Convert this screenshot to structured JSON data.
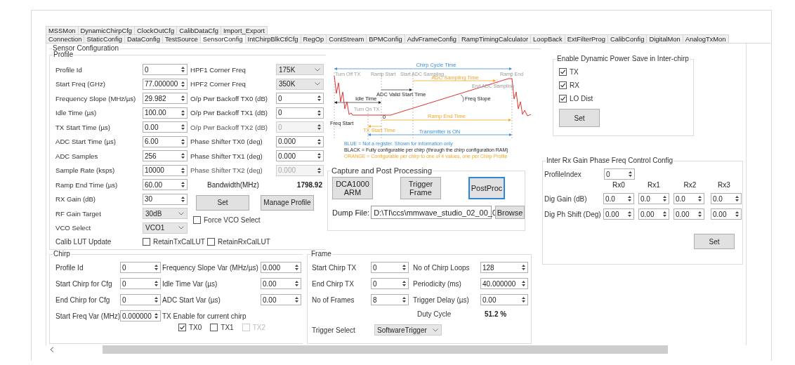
{
  "tabs_row1": [
    {
      "label": "MSSMon",
      "selected": false
    },
    {
      "label": "DynamicChirpCfg",
      "selected": false
    },
    {
      "label": "ClockOutCfg",
      "selected": false
    },
    {
      "label": "CalibDataCfg",
      "selected": false
    },
    {
      "label": "Import_Export",
      "selected": false
    }
  ],
  "tabs_row2": [
    {
      "label": "Connection",
      "selected": false
    },
    {
      "label": "StaticConfig",
      "selected": false
    },
    {
      "label": "DataConfig",
      "selected": false
    },
    {
      "label": "TestSource",
      "selected": false
    },
    {
      "label": "SensorConfig",
      "selected": true
    },
    {
      "label": "IntChirpBlkCtlCfg",
      "selected": false
    },
    {
      "label": "RegOp",
      "selected": false
    },
    {
      "label": "ContStream",
      "selected": false
    },
    {
      "label": "BPMConfig",
      "selected": false
    },
    {
      "label": "AdvFrameConfig",
      "selected": false
    },
    {
      "label": "RampTimingCalculator",
      "selected": false
    },
    {
      "label": "LoopBack",
      "selected": false
    },
    {
      "label": "ExtFilterProg",
      "selected": false
    },
    {
      "label": "CalibConfig",
      "selected": false
    },
    {
      "label": "DigitalMon",
      "selected": false
    },
    {
      "label": "AnalogTxMon",
      "selected": false
    }
  ],
  "sensor_configuration": {
    "title": "Sensor Configuration",
    "profile": {
      "title": "Profile",
      "left_fields": [
        {
          "label": "Profile Id",
          "value": "0",
          "kind": "spin"
        },
        {
          "label": "Start Freq (GHz)",
          "value": "77.000000",
          "kind": "spin"
        },
        {
          "label": "Frequency Slope (MHz/µs)",
          "value": "29.982",
          "kind": "spin"
        },
        {
          "label": "Idle Time (µs)",
          "value": "100.00",
          "kind": "spin"
        },
        {
          "label": "TX Start Time (µs)",
          "value": "0.00",
          "kind": "spin"
        },
        {
          "label": "ADC Start Time (µs)",
          "value": "6.00",
          "kind": "spin"
        },
        {
          "label": "ADC Samples",
          "value": "256",
          "kind": "spin"
        },
        {
          "label": "Sample Rate (ksps)",
          "value": "10000",
          "kind": "spin"
        },
        {
          "label": "Ramp End Time (µs)",
          "value": "60.00",
          "kind": "spin"
        },
        {
          "label": "RX Gain (dB)",
          "value": "30",
          "kind": "spin"
        },
        {
          "label": "RF Gain Target",
          "value": "30dB",
          "kind": "dropdown"
        },
        {
          "label": "VCO Select",
          "value": "VCO1",
          "kind": "dropdown"
        }
      ],
      "right_fields": [
        {
          "label": "HPF1 Corner Freq",
          "value": "175K",
          "kind": "dropdown",
          "disabled": false
        },
        {
          "label": "HPF2 Corner Freq",
          "value": "350K",
          "kind": "dropdown",
          "disabled": false
        },
        {
          "label": "O/p Pwr Backoff TX0 (dB)",
          "value": "0",
          "kind": "spin",
          "disabled": false
        },
        {
          "label": "O/p Pwr Backoff TX1 (dB)",
          "value": "0",
          "kind": "spin",
          "disabled": false
        },
        {
          "label": "O/p Pwr Backoff TX2 (dB)",
          "value": "0",
          "kind": "spin",
          "disabled": true
        },
        {
          "label": "Phase Shifter TX0 (deg)",
          "value": "0.000",
          "kind": "spin",
          "disabled": false
        },
        {
          "label": "Phase Shifter TX1 (deg)",
          "value": "0.000",
          "kind": "spin",
          "disabled": false
        },
        {
          "label": "Phase Shifter TX2 (deg)",
          "value": "0.000",
          "kind": "spin",
          "disabled": true
        }
      ],
      "bandwidth_label": "Bandwidth(MHz)",
      "bandwidth_value": "1798.92",
      "buttons": [
        "Set",
        "Manage Profile"
      ],
      "force_vco": {
        "label": "Force VCO Select",
        "checked": false
      },
      "calib_lut_label": "Calib LUT Update",
      "calib_lut_options": [
        {
          "label": "RetainTxCalLUT",
          "checked": false
        },
        {
          "label": "RetainRxCalLUT",
          "checked": false
        }
      ]
    },
    "diagram": {
      "labels": [
        {
          "text": "Chirp Cycle Time",
          "kind": "info"
        },
        {
          "text": "Turn Off TX",
          "kind": "marker"
        },
        {
          "text": "Ramp Start",
          "kind": "marker"
        },
        {
          "text": "Start ADC Sampling",
          "kind": "marker"
        },
        {
          "text": "ADC Sampling Time",
          "kind": "profile"
        },
        {
          "text": "Ramp End",
          "kind": "marker"
        },
        {
          "text": "ADC Valid Start Time",
          "kind": "chirp"
        },
        {
          "text": "End ADC Sampling",
          "kind": "marker"
        },
        {
          "text": "Freq Slope",
          "kind": "chirp"
        },
        {
          "text": "Idle Time",
          "kind": "chirp"
        },
        {
          "text": "Turn On TX",
          "kind": "marker"
        },
        {
          "text": "0",
          "kind": "chirp"
        },
        {
          "text": "Freq Start",
          "kind": "chirp"
        },
        {
          "text": "Ramp End Time",
          "kind": "profile"
        },
        {
          "text": "TX Start Time",
          "kind": "profile"
        },
        {
          "text": "Transmitter is ON",
          "kind": "info"
        }
      ],
      "legend": [
        {
          "text": "BLUE = Not a register. Shown for information only",
          "kind": "info"
        },
        {
          "text": "BLACK = Fully configurable per chirp (through the chirp configuration RAM)",
          "kind": "chirp"
        },
        {
          "text": "ORANGE = Configurable per chirp to one of 4 values, one per Chirp Profile",
          "kind": "profile"
        }
      ]
    },
    "capture": {
      "title": "Capture and Post Processing",
      "buttons": [
        {
          "label": "DCA1000 ARM",
          "focused": false
        },
        {
          "label": "Trigger Frame",
          "focused": false
        },
        {
          "label": "PostProc",
          "focused": true
        }
      ],
      "dump_label": "Dump File:",
      "dump_value": "D:\\TI\\ccs\\mmwave_studio_02_00_0",
      "browse": "Browse"
    }
  },
  "chirp": {
    "title": "Chirp",
    "left_fields": [
      {
        "label": "Profile Id",
        "value": "0"
      },
      {
        "label": "Start Chirp for Cfg",
        "value": "0"
      },
      {
        "label": "End Chirp for Cfg",
        "value": "0"
      },
      {
        "label": "Start Freq Var (MHz)",
        "value": "0.000000"
      }
    ],
    "right_fields": [
      {
        "label": "Frequency Slope Var (MHz/µs)",
        "value": "0.000"
      },
      {
        "label": "Idle Time Var (µs)",
        "value": "0.00"
      },
      {
        "label": "ADC Start Var (µs)",
        "value": "0.00"
      }
    ],
    "tx_enable_label": "TX Enable for current chirp",
    "tx_enable": [
      {
        "label": "TX0",
        "checked": true,
        "disabled": false
      },
      {
        "label": "TX1",
        "checked": false,
        "disabled": false
      },
      {
        "label": "TX2",
        "checked": false,
        "disabled": true
      }
    ]
  },
  "frame": {
    "title": "Frame",
    "left_fields": [
      {
        "label": "Start Chirp TX",
        "value": "0"
      },
      {
        "label": "End Chirp TX",
        "value": "0"
      },
      {
        "label": "No of Frames",
        "value": "8"
      }
    ],
    "right_fields": [
      {
        "label": "No of Chirp Loops",
        "value": "128"
      },
      {
        "label": "Periodicity (ms)",
        "value": "40.000000"
      },
      {
        "label": "Trigger Delay (µs)",
        "value": "0.00"
      }
    ],
    "duty_cycle_label": "Duty Cycle",
    "duty_cycle_value": "51.2 %",
    "trigger_select_label": "Trigger Select",
    "trigger_select_value": "SoftwareTrigger"
  },
  "dynamic_power_save": {
    "title": "Enable Dynamic Power Save in Inter-chirp",
    "options": [
      {
        "label": "TX",
        "checked": true
      },
      {
        "label": "RX",
        "checked": true
      },
      {
        "label": "LO Dist",
        "checked": true
      }
    ],
    "button": "Set"
  },
  "inter_rx": {
    "title": "Inter Rx Gain Phase Freq Control Config",
    "profile_index_label": "ProfileIndex",
    "profile_index_value": "0",
    "columns": [
      "Rx0",
      "Rx1",
      "Rx2",
      "Rx3"
    ],
    "rows": [
      {
        "label": "Dig Gain (dB)",
        "values": [
          "0.0",
          "0.0",
          "0.0",
          "0.0"
        ]
      },
      {
        "label": "Dig Ph Shift (Deg)",
        "values": [
          "0.00",
          "0.00",
          "0.00",
          "0.00"
        ]
      }
    ],
    "button": "Set"
  }
}
